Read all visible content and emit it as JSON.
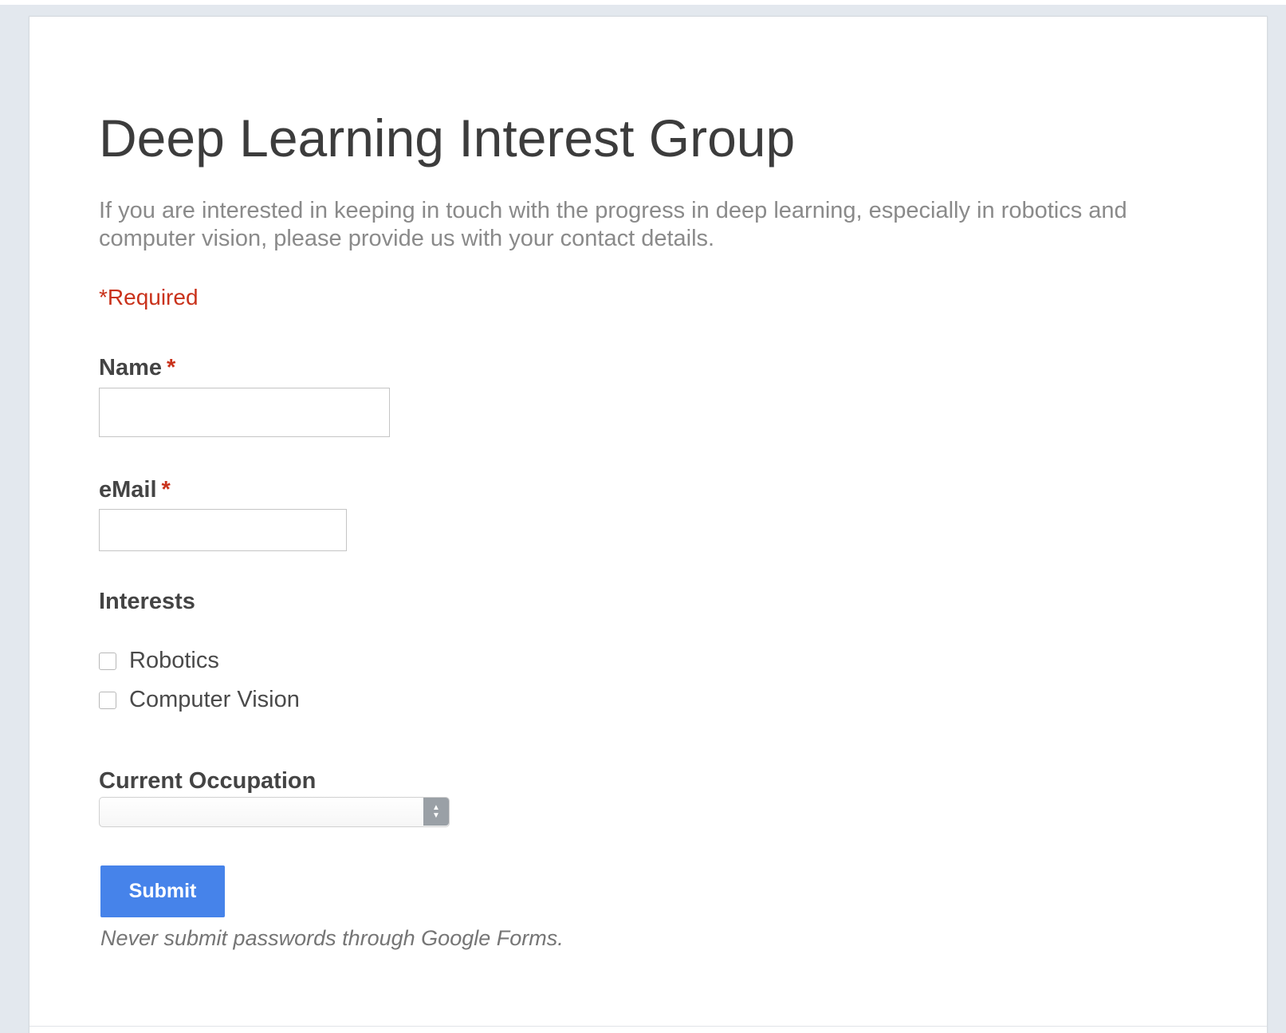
{
  "form": {
    "title": "Deep Learning Interest Group",
    "description": "If you are interested in keeping in touch with the progress in deep learning, especially in robotics and computer vision, please provide us with your contact details.",
    "required_note": "*Required"
  },
  "fields": {
    "name": {
      "label": "Name",
      "required_marker": "*",
      "value": ""
    },
    "email": {
      "label": "eMail",
      "required_marker": "*",
      "value": ""
    },
    "interests": {
      "label": "Interests",
      "options": [
        {
          "label": "Robotics",
          "checked": false
        },
        {
          "label": "Computer Vision",
          "checked": false
        }
      ]
    },
    "occupation": {
      "label": "Current Occupation",
      "selected": ""
    }
  },
  "actions": {
    "submit_label": "Submit"
  },
  "footer": {
    "note": "Never submit passwords through Google Forms."
  },
  "colors": {
    "required": "#c9321b",
    "submit_button": "#4683ea",
    "background": "#e3e8ee"
  }
}
